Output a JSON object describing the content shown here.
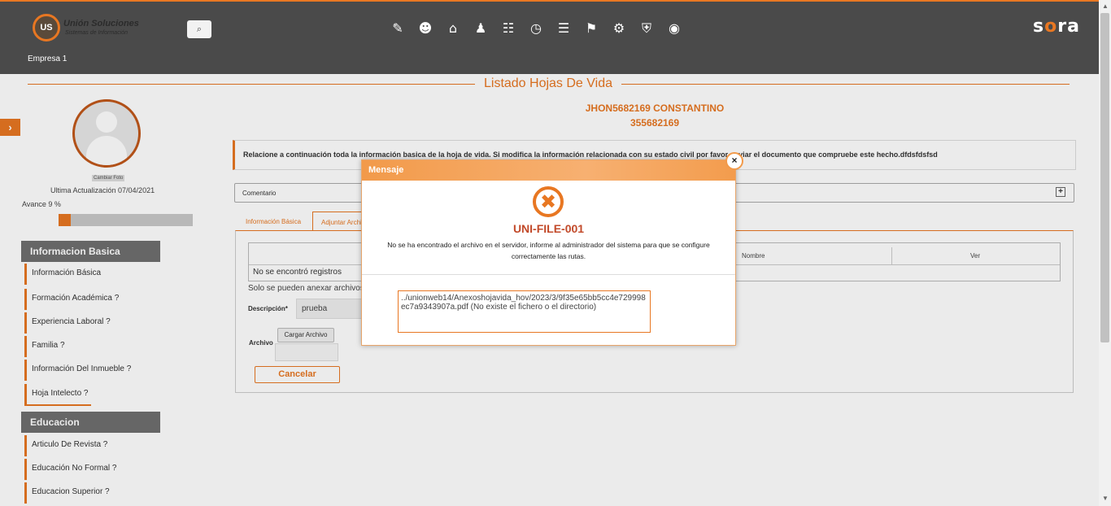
{
  "header": {
    "logo_initials": "US",
    "logo_title": "Unión Soluciones",
    "logo_subtitle": "Sistemas de Información",
    "search_icon": "⌕",
    "brand_prefix": "s",
    "brand_o": "o",
    "brand_suffix": "ra",
    "company": "Empresa 1",
    "menu_icons": [
      "document-edit-icon",
      "person-upload-icon",
      "gift-icon",
      "org-chart-icon",
      "people-card-icon",
      "stopwatch-icon",
      "list-document-icon",
      "presentation-icon",
      "gears-icon",
      "shield-vehicle-icon",
      "eye-icon"
    ]
  },
  "page": {
    "title": "Listado Hojas De Vida",
    "person_name": "JHON5682169 CONSTANTINO",
    "person_id": "355682169"
  },
  "profile": {
    "change_photo": "Cambiar Foto",
    "last_update": "Ultima Actualización 07/04/2021",
    "progress_label": "Avance 9 %",
    "progress_percent": 9
  },
  "sidebar": {
    "section1_title": "Informacion Basica",
    "section1_items": [
      "Información Básica",
      "Formación Académica  ?",
      "Experiencia Laboral  ?",
      "Familia  ?",
      "Información Del Inmueble  ?",
      "Hoja Intelecto  ?"
    ],
    "section2_title": "Educacion",
    "section2_items": [
      "Articulo De Revista  ?",
      "Educación No Formal  ?",
      "Educacion Superior  ?"
    ]
  },
  "main": {
    "info_text": "Relacione a continuación toda la información basica de la hoja de vida. Si modifica la información relacionada con su estado civil por favor enviar el documento que compruebe este hecho.dfdsfdsfsd",
    "comment_label": "Comentario",
    "tabs": [
      "Información Básica",
      "Adjuntar Archivos"
    ],
    "grid_columns": [
      "Nombre",
      "Ver"
    ],
    "no_records": "No se encontró registros",
    "annex_note": "Solo se pueden anexar archivos",
    "description_label": "Descripción*",
    "description_value": "prueba",
    "file_label": "Archivo",
    "upload_button": "Cargar Archivo",
    "cancel_button": "Cancelar"
  },
  "modal": {
    "title": "Mensaje",
    "close": "×",
    "error_icon": "✖",
    "error_code": "UNI-FILE-001",
    "message": "No se ha encontrado el archivo en el servidor, informe al administrador del sistema para que se configure correctamente las rutas.",
    "detail": "../unionweb14/Anexoshojavida_hov/2023/3/9f35e65bb5cc4e729998ec7a9343907a.pdf (No existe el fichero o el directorio)"
  }
}
